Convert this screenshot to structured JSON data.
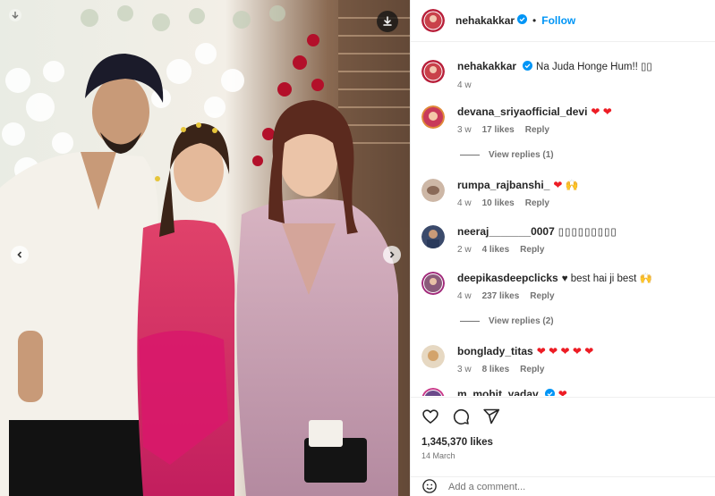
{
  "post": {
    "author": "nehakakkar",
    "follow_label": "Follow",
    "separator": "•",
    "caption": "Na Juda Honge Hum!! ▯▯",
    "caption_age": "4 w"
  },
  "comments": [
    {
      "user": "devana_sriyaofficial_devi",
      "text": "",
      "hearts": "❤ ❤",
      "age": "3 w",
      "likes": "17 likes",
      "reply": "Reply",
      "avatar_color": "#c83a5a"
    },
    {
      "user": "rumpa_rajbanshi_",
      "text": "",
      "hearts": "❤ 🙌",
      "age": "4 w",
      "likes": "10 likes",
      "reply": "Reply",
      "avatar_color": "#b59a86"
    },
    {
      "user": "neeraj_______0007",
      "text": "▯▯▯▯▯▯▯▯▯",
      "hearts": "",
      "age": "2 w",
      "likes": "4 likes",
      "reply": "Reply",
      "avatar_color": "#3b4a6b"
    },
    {
      "user": "deepikasdeepclicks",
      "text": "♥ best hai ji best 🙌",
      "hearts": "",
      "age": "4 w",
      "likes": "237 likes",
      "reply": "Reply",
      "avatar_color": "#8a5a7a"
    },
    {
      "user": "bonglady_titas",
      "text": "",
      "hearts": "❤ ❤ ❤ ❤ ❤",
      "age": "3 w",
      "likes": "8 likes",
      "reply": "Reply",
      "avatar_color": "#d3a36b"
    },
    {
      "user": "m_mohit_yadav",
      "text": "",
      "hearts": "❤",
      "age": "",
      "likes": "",
      "reply": "",
      "avatar_color": "#6b4a8a"
    }
  ],
  "view_replies": [
    {
      "label": "View replies (1)"
    },
    {
      "label": "View replies (2)"
    }
  ],
  "stats": {
    "likes": "1,345,370 likes",
    "date": "14 March"
  },
  "composer": {
    "placeholder": "Add a comment..."
  },
  "icons": {
    "download": "download-icon",
    "heart": "heart-icon",
    "comment": "comment-icon",
    "share": "share-icon",
    "emoji": "emoji-icon",
    "verified": "verified-badge-icon"
  },
  "colors": {
    "accent": "#0095f6",
    "verified": "#0095f6",
    "heart": "#ed1c24",
    "meta": "#737373"
  }
}
